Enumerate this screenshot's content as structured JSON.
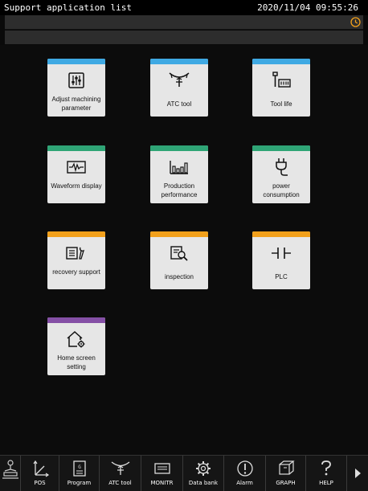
{
  "header": {
    "title": "Support application list",
    "datetime": "2020/11/04 09:55:26"
  },
  "tiles": [
    {
      "label": "Adjust machining parameter",
      "icon": "sliders-icon",
      "color": "#3fa9e3"
    },
    {
      "label": "ATC tool",
      "icon": "atc-tool-icon",
      "color": "#3fa9e3"
    },
    {
      "label": "Tool life",
      "icon": "tool-life-icon",
      "color": "#3fa9e3"
    },
    {
      "label": "Waveform display",
      "icon": "waveform-icon",
      "color": "#2fa576"
    },
    {
      "label": "Production performance",
      "icon": "bar-chart-icon",
      "color": "#2fa576"
    },
    {
      "label": "power consumption",
      "icon": "plug-icon",
      "color": "#2fa576"
    },
    {
      "label": "recovery support",
      "icon": "recovery-icon",
      "color": "#f2a01b"
    },
    {
      "label": "inspection",
      "icon": "inspection-icon",
      "color": "#f2a01b"
    },
    {
      "label": "PLC",
      "icon": "plc-contact-icon",
      "color": "#f2a01b"
    },
    {
      "label": "Home screen setting",
      "icon": "home-gear-icon",
      "color": "#8550a6"
    }
  ],
  "softkeys": [
    {
      "label": "",
      "icon": "machine-icon"
    },
    {
      "label": "POS",
      "icon": "axes-icon"
    },
    {
      "label": "Program",
      "icon": "program-icon"
    },
    {
      "label": "ATC tool",
      "icon": "atc-tool-icon"
    },
    {
      "label": "MONITR",
      "icon": "monitor-icon"
    },
    {
      "label": "Data bank",
      "icon": "gear-icon"
    },
    {
      "label": "Alarm",
      "icon": "alarm-icon"
    },
    {
      "label": "GRAPH",
      "icon": "graph-icon"
    },
    {
      "label": "HELP",
      "icon": "help-icon"
    },
    {
      "label": "",
      "icon": "next-page-icon"
    }
  ]
}
